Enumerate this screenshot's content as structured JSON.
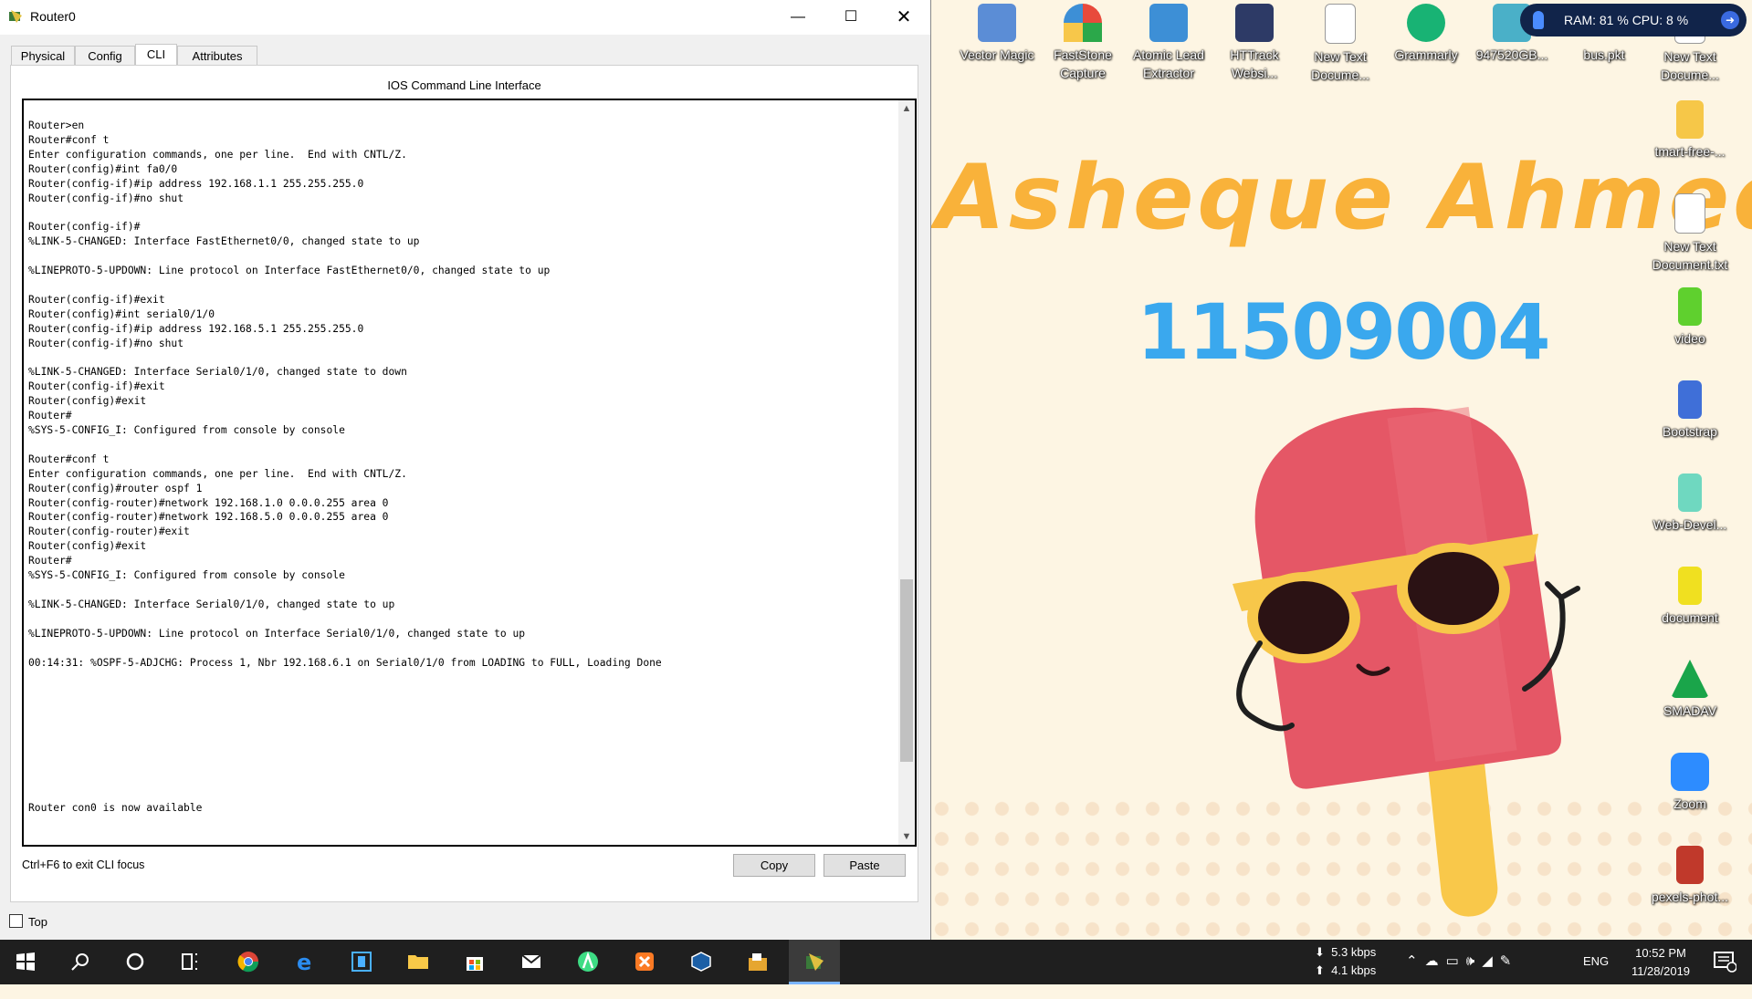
{
  "window": {
    "title": "Router0",
    "tabs": [
      {
        "label": "Physical"
      },
      {
        "label": "Config"
      },
      {
        "label": "CLI"
      },
      {
        "label": "Attributes"
      }
    ],
    "cli_title": "IOS Command Line Interface",
    "console_lines": [
      "Router>en",
      "Router#conf t",
      "Enter configuration commands, one per line.  End with CNTL/Z.",
      "Router(config)#int fa0/0",
      "Router(config-if)#ip address 192.168.1.1 255.255.255.0",
      "Router(config-if)#no shut",
      "",
      "Router(config-if)#",
      "%LINK-5-CHANGED: Interface FastEthernet0/0, changed state to up",
      "",
      "%LINEPROTO-5-UPDOWN: Line protocol on Interface FastEthernet0/0, changed state to up",
      "",
      "Router(config-if)#exit",
      "Router(config)#int serial0/1/0",
      "Router(config-if)#ip address 192.168.5.1 255.255.255.0",
      "Router(config-if)#no shut",
      "",
      "%LINK-5-CHANGED: Interface Serial0/1/0, changed state to down",
      "Router(config-if)#exit",
      "Router(config)#exit",
      "Router#",
      "%SYS-5-CONFIG_I: Configured from console by console",
      "",
      "Router#conf t",
      "Enter configuration commands, one per line.  End with CNTL/Z.",
      "Router(config)#router ospf 1",
      "Router(config-router)#network 192.168.1.0 0.0.0.255 area 0",
      "Router(config-router)#network 192.168.5.0 0.0.0.255 area 0",
      "Router(config-router)#exit",
      "Router(config)#exit",
      "Router#",
      "%SYS-5-CONFIG_I: Configured from console by console",
      "",
      "%LINK-5-CHANGED: Interface Serial0/1/0, changed state to up",
      "",
      "%LINEPROTO-5-UPDOWN: Line protocol on Interface Serial0/1/0, changed state to up",
      "",
      "00:14:31: %OSPF-5-ADJCHG: Process 1, Nbr 192.168.6.1 on Serial0/1/0 from LOADING to FULL, Loading Done",
      "",
      "",
      "",
      "",
      "",
      "",
      "",
      "",
      "",
      "Router con0 is now available"
    ],
    "hint": "Ctrl+F6 to exit CLI focus",
    "copy_label": "Copy",
    "paste_label": "Paste",
    "top_label": "Top"
  },
  "desktop": {
    "wallpaper_name": "Asheque Ahmed",
    "wallpaper_id": "11509004",
    "perf": "RAM: 81 %  CPU: 8 %",
    "icons": [
      {
        "label": "Vector Magic"
      },
      {
        "label": "FastStone Capture"
      },
      {
        "label": "Atomic Lead Extractor"
      },
      {
        "label": "HTTrack Websi..."
      },
      {
        "label": "New Text Docume..."
      },
      {
        "label": "Grammarly"
      },
      {
        "label": "947520GB..."
      },
      {
        "label": "bus.pkt"
      },
      {
        "label": "New Text Docume..."
      },
      {
        "label": "tmart-free-..."
      },
      {
        "label": "New Text Document.txt"
      },
      {
        "label": "video"
      },
      {
        "label": "Bootstrap"
      },
      {
        "label": "Web-Devel..."
      },
      {
        "label": "document"
      },
      {
        "label": "SMADAV"
      },
      {
        "label": "Zoom"
      },
      {
        "label": "pexels-phot..."
      }
    ],
    "icon_colors": [
      "#5b8dd6",
      "#e84a3c",
      "#3d8fd6",
      "#2d3a66",
      "#ffffff",
      "#18b374",
      "#4ab0c8",
      "#cccccc",
      "#ffffff",
      "#f6c748",
      "#ffffff",
      "#5fd02e",
      "#3f6fd8",
      "#6fd8c0",
      "#f0e020",
      "#1aa54a",
      "#2d8cff",
      "#c0392b"
    ]
  },
  "taskbar": {
    "upload": "5.3 kbps",
    "download": "4.1 kbps",
    "lang": "ENG",
    "time": "10:52 PM",
    "date": "11/28/2019"
  }
}
